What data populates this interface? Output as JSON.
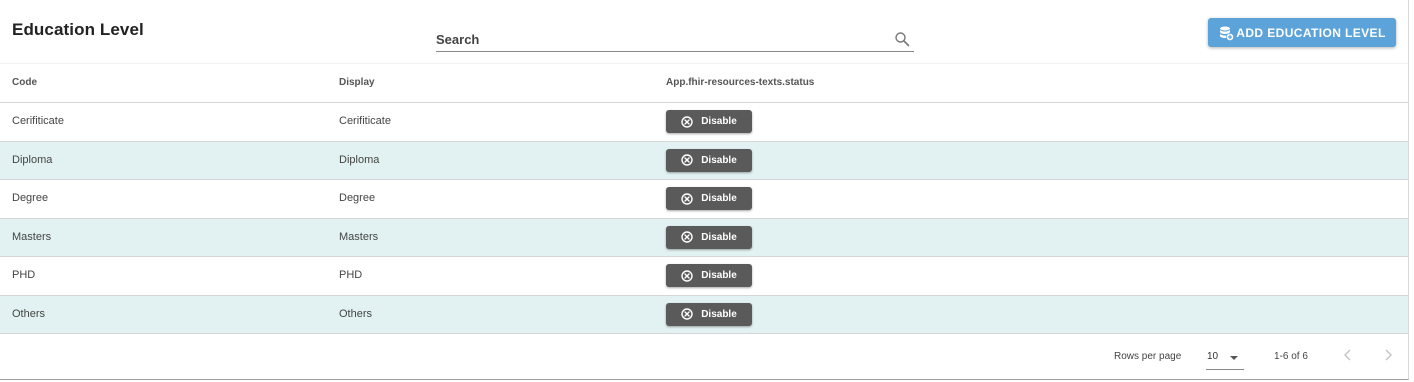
{
  "header": {
    "title": "Education Level",
    "search_placeholder": "Search",
    "search_value": "",
    "add_button_label": "ADD EDUCATION LEVEL"
  },
  "table": {
    "columns": [
      "Code",
      "Display",
      "App.fhir-resources-texts.status"
    ],
    "rows": [
      {
        "code": "Cerifiticate",
        "display": "Cerifiticate",
        "status_label": "Disable"
      },
      {
        "code": "Diploma",
        "display": "Diploma",
        "status_label": "Disable"
      },
      {
        "code": "Degree",
        "display": "Degree",
        "status_label": "Disable"
      },
      {
        "code": "Masters",
        "display": "Masters",
        "status_label": "Disable"
      },
      {
        "code": "PHD",
        "display": "PHD",
        "status_label": "Disable"
      },
      {
        "code": "Others",
        "display": "Others",
        "status_label": "Disable"
      }
    ]
  },
  "pagination": {
    "rows_per_page_label": "Rows per page",
    "rows_per_page_value": "10",
    "range_text": "1-6 of 6"
  },
  "colors": {
    "accent": "#5ba3d9",
    "row_alt": "#e2f2f2",
    "status_button": "#5a5a5a"
  },
  "icons": {
    "search": "search-icon",
    "add": "database-plus-icon",
    "status": "circle-x-icon",
    "prev": "chevron-left-icon",
    "next": "chevron-right-icon",
    "dropdown": "caret-down-icon"
  }
}
